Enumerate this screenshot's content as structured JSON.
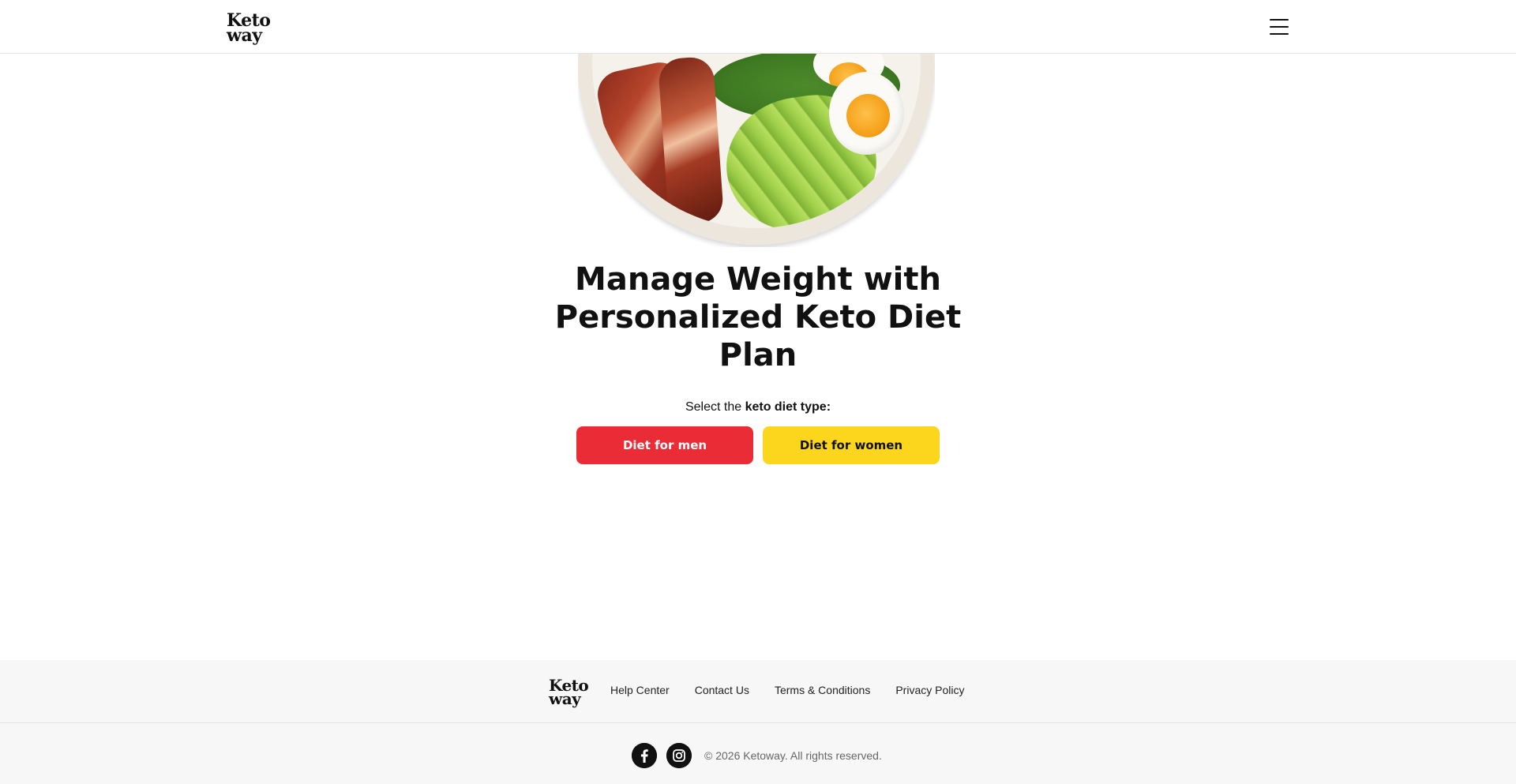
{
  "header": {
    "logo_line1": "Keto",
    "logo_line2": "way",
    "menu_icon": "hamburger-menu-icon"
  },
  "hero": {
    "image_alt": "keto bowl with bacon, avocado and soft-boiled eggs",
    "headline": "Manage Weight with Personalized Keto Diet Plan",
    "prompt_prefix": "Select the ",
    "prompt_bold": "keto diet type:",
    "buttons": {
      "men": "Diet for men",
      "women": "Diet for women"
    },
    "colors": {
      "men_button": "#ea2c37",
      "women_button": "#fcd61c"
    }
  },
  "footer": {
    "logo_line1": "Keto",
    "logo_line2": "way",
    "links": [
      "Help Center",
      "Contact Us",
      "Terms & Conditions",
      "Privacy Policy"
    ],
    "social": [
      "facebook-icon",
      "instagram-icon"
    ],
    "copyright": "© 2026 Ketoway. All rights reserved."
  }
}
